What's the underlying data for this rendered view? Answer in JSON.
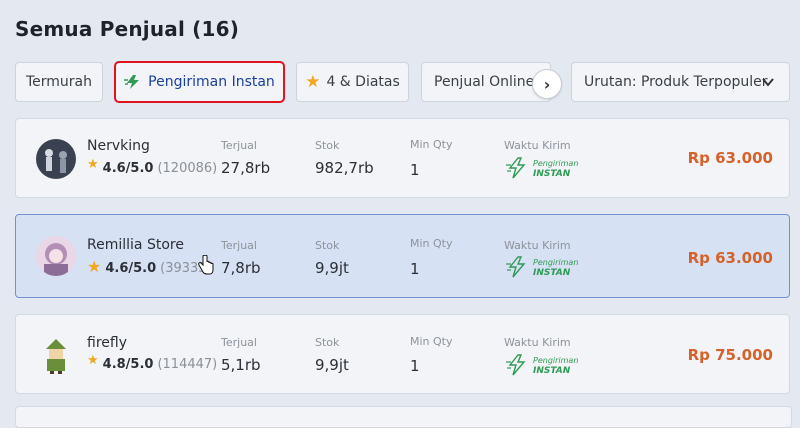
{
  "page": {
    "title": "Semua Penjual (16)"
  },
  "filters": {
    "cheapest": "Termurah",
    "instant": "Pengiriman Instan",
    "rating": "4 & Diatas",
    "online": "Penjual Online",
    "sort": "Urutan: Produk Terpopuler"
  },
  "labels": {
    "sold": "Terjual",
    "stock": "Stok",
    "min_qty": "Min Qty",
    "ship_time": "Waktu Kirim",
    "instant_top": "Pengiriman",
    "instant_bottom": "INSTAN"
  },
  "sellers": [
    {
      "name": "Nervking",
      "rating": "4.6/5.0",
      "reviews": "(120086)",
      "sold": "27,8rb",
      "stock": "982,7rb",
      "min_qty": "1",
      "price": "Rp 63.000"
    },
    {
      "name": "Remillia Store",
      "rating": "4.6/5.0",
      "reviews": "(39335)",
      "sold": "7,8rb",
      "stock": "9,9jt",
      "min_qty": "1",
      "price": "Rp 63.000"
    },
    {
      "name": "firefly",
      "rating": "4.8/5.0",
      "reviews": "(114447)",
      "sold": "5,1rb",
      "stock": "9,9jt",
      "min_qty": "1",
      "price": "Rp 75.000"
    }
  ],
  "colors": {
    "accent": "#1a3f9c",
    "price": "#d4622a",
    "instant": "#2f9a55",
    "highlight": "#e0141e",
    "star": "#f0a722"
  }
}
